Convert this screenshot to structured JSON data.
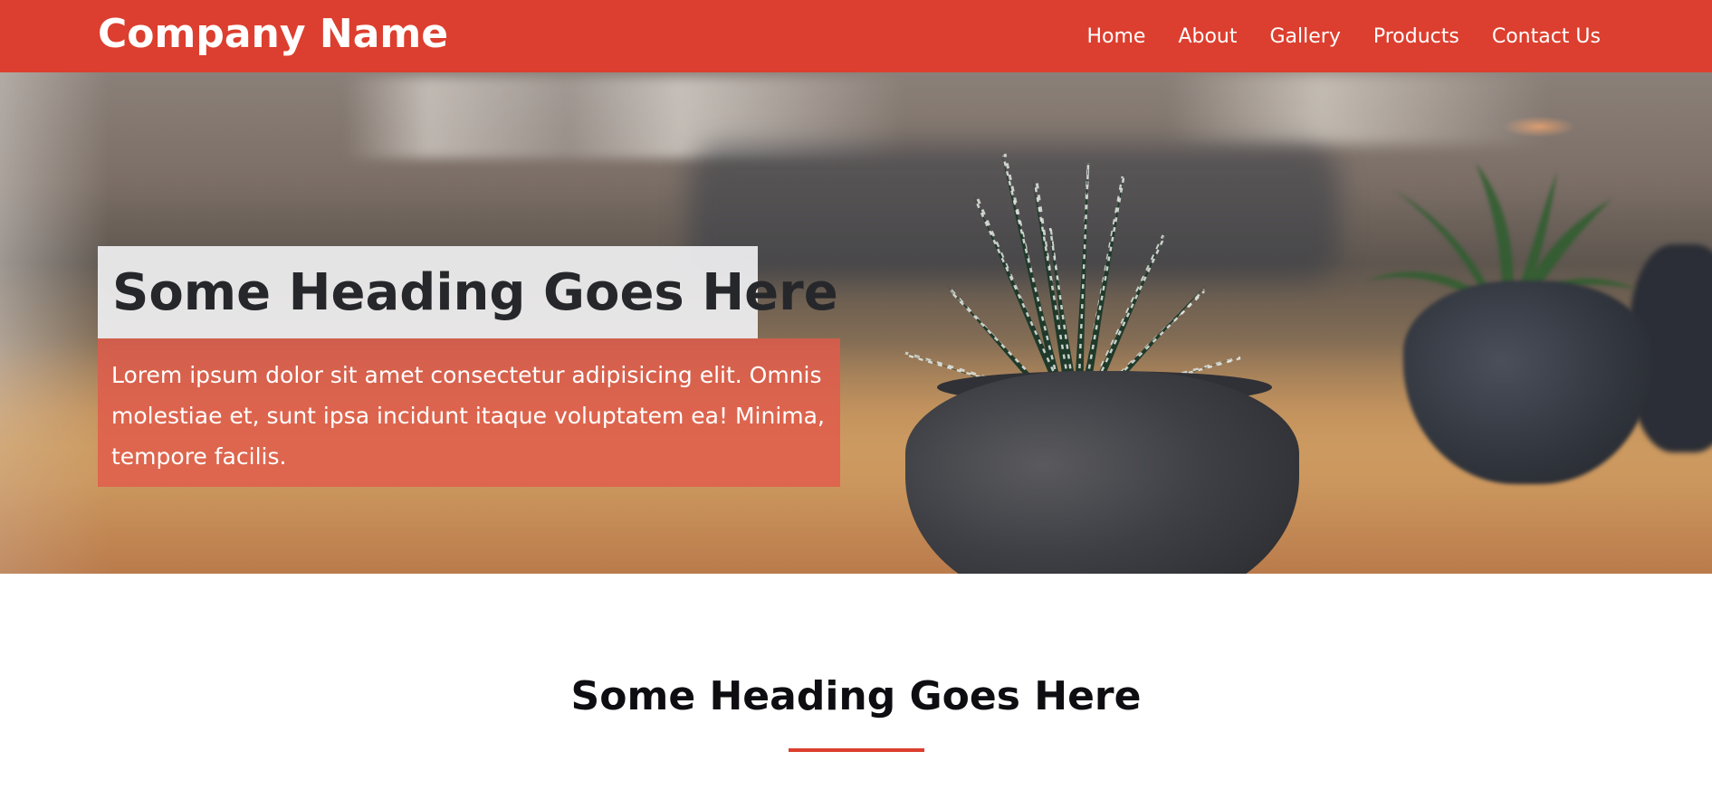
{
  "navbar": {
    "brand": "Company Name",
    "links": [
      {
        "label": "Home"
      },
      {
        "label": "About"
      },
      {
        "label": "Gallery"
      },
      {
        "label": "Products"
      },
      {
        "label": "Contact Us"
      }
    ]
  },
  "hero": {
    "title": "Some Heading Goes Here",
    "text": "Lorem ipsum dolor sit amet consectetur adipisicing elit. Omnis molestiae et, sunt ipsa incidunt itaque voluptatem ea! Minima, tempore facilis."
  },
  "section": {
    "title": "Some Heading Goes Here"
  },
  "colors": {
    "accent": "#dc3f2f",
    "hero_text_box": "#e25a4a",
    "hero_title_box": "#f0f0f2"
  }
}
